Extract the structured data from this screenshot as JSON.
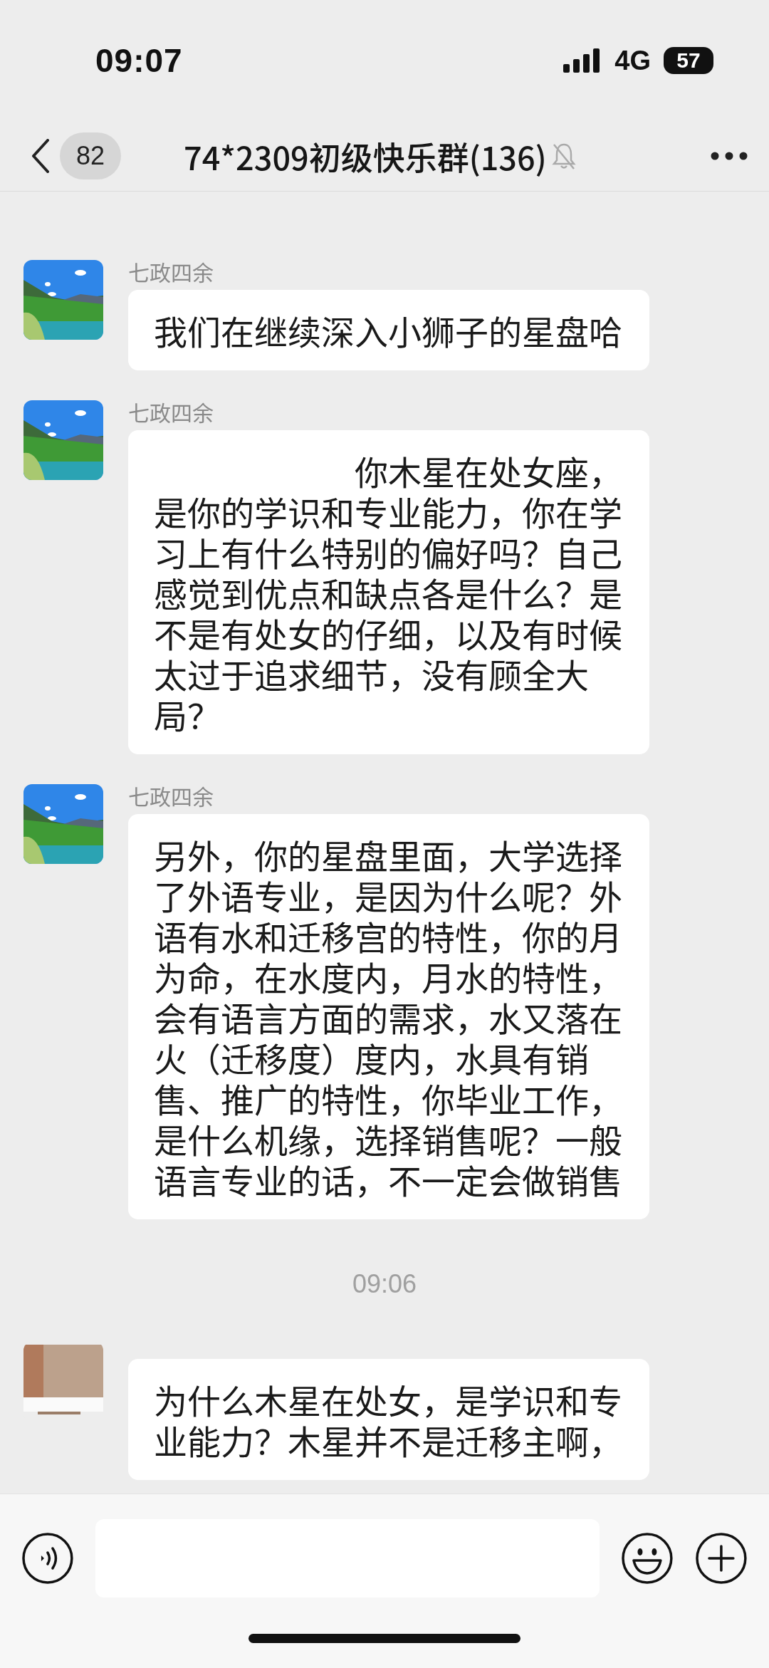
{
  "status_bar": {
    "time": "09:07",
    "network": "4G",
    "battery": "57"
  },
  "nav": {
    "back_badge": "82",
    "title": "74*2309初级快乐群(136)",
    "muted": true
  },
  "messages": [
    {
      "kind": "message",
      "sender": "七政四余",
      "text": "我们在继续深入小狮子的星盘哈"
    },
    {
      "kind": "message",
      "sender": "七政四余",
      "text": "　　　　　　你木星在处女座，是你的学识和专业能力，你在学习上有什么特别的偏好吗？自己感觉到优点和缺点各是什么？是不是有处女的仔细，以及有时候太过于追求细节，没有顾全大局？"
    },
    {
      "kind": "message",
      "sender": "七政四余",
      "text": "另外，你的星盘里面，大学选择了外语专业，是因为什么呢？外语有水和迁移宫的特性，你的月为命，在水度内，月水的特性，会有语言方面的需求，水又落在火（迁移度）度内，水具有销售、推广的特性，你毕业工作，是什么机缘，选择销售呢？一般语言专业的话，不一定会做销售"
    },
    {
      "kind": "timestamp",
      "text": "09:06"
    },
    {
      "kind": "message",
      "text": "为什么木星在处女，是学识和专业能力？木星并不是迁移主啊，"
    }
  ]
}
